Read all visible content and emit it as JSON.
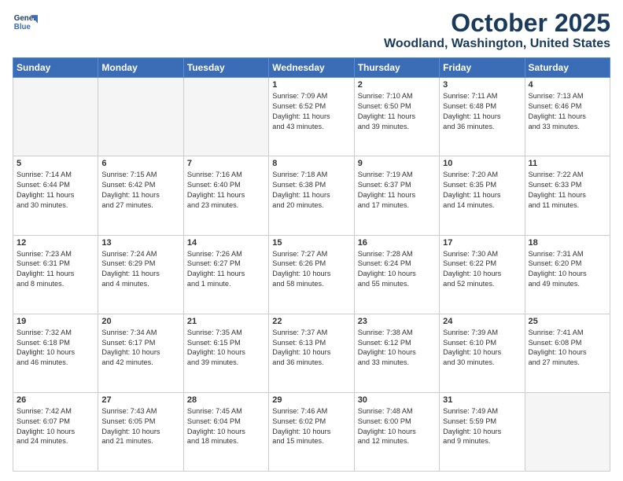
{
  "logo": {
    "line1": "General",
    "line2": "Blue"
  },
  "title": "October 2025",
  "location": "Woodland, Washington, United States",
  "days_of_week": [
    "Sunday",
    "Monday",
    "Tuesday",
    "Wednesday",
    "Thursday",
    "Friday",
    "Saturday"
  ],
  "weeks": [
    [
      {
        "day": "",
        "info": ""
      },
      {
        "day": "",
        "info": ""
      },
      {
        "day": "",
        "info": ""
      },
      {
        "day": "1",
        "info": "Sunrise: 7:09 AM\nSunset: 6:52 PM\nDaylight: 11 hours\nand 43 minutes."
      },
      {
        "day": "2",
        "info": "Sunrise: 7:10 AM\nSunset: 6:50 PM\nDaylight: 11 hours\nand 39 minutes."
      },
      {
        "day": "3",
        "info": "Sunrise: 7:11 AM\nSunset: 6:48 PM\nDaylight: 11 hours\nand 36 minutes."
      },
      {
        "day": "4",
        "info": "Sunrise: 7:13 AM\nSunset: 6:46 PM\nDaylight: 11 hours\nand 33 minutes."
      }
    ],
    [
      {
        "day": "5",
        "info": "Sunrise: 7:14 AM\nSunset: 6:44 PM\nDaylight: 11 hours\nand 30 minutes."
      },
      {
        "day": "6",
        "info": "Sunrise: 7:15 AM\nSunset: 6:42 PM\nDaylight: 11 hours\nand 27 minutes."
      },
      {
        "day": "7",
        "info": "Sunrise: 7:16 AM\nSunset: 6:40 PM\nDaylight: 11 hours\nand 23 minutes."
      },
      {
        "day": "8",
        "info": "Sunrise: 7:18 AM\nSunset: 6:38 PM\nDaylight: 11 hours\nand 20 minutes."
      },
      {
        "day": "9",
        "info": "Sunrise: 7:19 AM\nSunset: 6:37 PM\nDaylight: 11 hours\nand 17 minutes."
      },
      {
        "day": "10",
        "info": "Sunrise: 7:20 AM\nSunset: 6:35 PM\nDaylight: 11 hours\nand 14 minutes."
      },
      {
        "day": "11",
        "info": "Sunrise: 7:22 AM\nSunset: 6:33 PM\nDaylight: 11 hours\nand 11 minutes."
      }
    ],
    [
      {
        "day": "12",
        "info": "Sunrise: 7:23 AM\nSunset: 6:31 PM\nDaylight: 11 hours\nand 8 minutes."
      },
      {
        "day": "13",
        "info": "Sunrise: 7:24 AM\nSunset: 6:29 PM\nDaylight: 11 hours\nand 4 minutes."
      },
      {
        "day": "14",
        "info": "Sunrise: 7:26 AM\nSunset: 6:27 PM\nDaylight: 11 hours\nand 1 minute."
      },
      {
        "day": "15",
        "info": "Sunrise: 7:27 AM\nSunset: 6:26 PM\nDaylight: 10 hours\nand 58 minutes."
      },
      {
        "day": "16",
        "info": "Sunrise: 7:28 AM\nSunset: 6:24 PM\nDaylight: 10 hours\nand 55 minutes."
      },
      {
        "day": "17",
        "info": "Sunrise: 7:30 AM\nSunset: 6:22 PM\nDaylight: 10 hours\nand 52 minutes."
      },
      {
        "day": "18",
        "info": "Sunrise: 7:31 AM\nSunset: 6:20 PM\nDaylight: 10 hours\nand 49 minutes."
      }
    ],
    [
      {
        "day": "19",
        "info": "Sunrise: 7:32 AM\nSunset: 6:18 PM\nDaylight: 10 hours\nand 46 minutes."
      },
      {
        "day": "20",
        "info": "Sunrise: 7:34 AM\nSunset: 6:17 PM\nDaylight: 10 hours\nand 42 minutes."
      },
      {
        "day": "21",
        "info": "Sunrise: 7:35 AM\nSunset: 6:15 PM\nDaylight: 10 hours\nand 39 minutes."
      },
      {
        "day": "22",
        "info": "Sunrise: 7:37 AM\nSunset: 6:13 PM\nDaylight: 10 hours\nand 36 minutes."
      },
      {
        "day": "23",
        "info": "Sunrise: 7:38 AM\nSunset: 6:12 PM\nDaylight: 10 hours\nand 33 minutes."
      },
      {
        "day": "24",
        "info": "Sunrise: 7:39 AM\nSunset: 6:10 PM\nDaylight: 10 hours\nand 30 minutes."
      },
      {
        "day": "25",
        "info": "Sunrise: 7:41 AM\nSunset: 6:08 PM\nDaylight: 10 hours\nand 27 minutes."
      }
    ],
    [
      {
        "day": "26",
        "info": "Sunrise: 7:42 AM\nSunset: 6:07 PM\nDaylight: 10 hours\nand 24 minutes."
      },
      {
        "day": "27",
        "info": "Sunrise: 7:43 AM\nSunset: 6:05 PM\nDaylight: 10 hours\nand 21 minutes."
      },
      {
        "day": "28",
        "info": "Sunrise: 7:45 AM\nSunset: 6:04 PM\nDaylight: 10 hours\nand 18 minutes."
      },
      {
        "day": "29",
        "info": "Sunrise: 7:46 AM\nSunset: 6:02 PM\nDaylight: 10 hours\nand 15 minutes."
      },
      {
        "day": "30",
        "info": "Sunrise: 7:48 AM\nSunset: 6:00 PM\nDaylight: 10 hours\nand 12 minutes."
      },
      {
        "day": "31",
        "info": "Sunrise: 7:49 AM\nSunset: 5:59 PM\nDaylight: 10 hours\nand 9 minutes."
      },
      {
        "day": "",
        "info": ""
      }
    ]
  ]
}
